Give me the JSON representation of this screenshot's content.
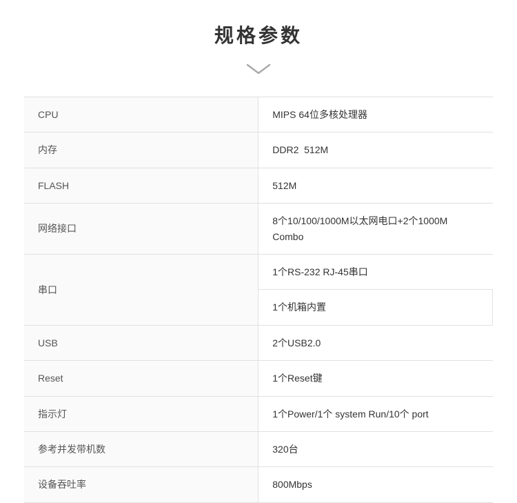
{
  "header": {
    "title": "规格参数"
  },
  "specs": [
    {
      "label": "CPU",
      "value": "MIPS 64位多核处理器",
      "multiline": false
    },
    {
      "label": "内存",
      "value": "DDR2  512M",
      "multiline": false
    },
    {
      "label": "FLASH",
      "value": "512M",
      "multiline": false
    },
    {
      "label": "网络接口",
      "value": "8个10/100/1000M以太网电口+2个1000M Combo",
      "multiline": false
    },
    {
      "label": "串口",
      "value1": "1个RS-232 RJ-45串口",
      "value2": "1个机箱内置",
      "multiline": true
    },
    {
      "label": "USB",
      "value": "2个USB2.0",
      "multiline": false
    },
    {
      "label": "Reset",
      "value": "1个Reset键",
      "multiline": false
    },
    {
      "label": "指示灯",
      "value": "1个Power/1个 system Run/10个 port",
      "multiline": false
    },
    {
      "label": "参考并发带机数",
      "value": "320台",
      "multiline": false
    },
    {
      "label": "设备吞吐率",
      "value": "800Mbps",
      "multiline": false
    }
  ]
}
